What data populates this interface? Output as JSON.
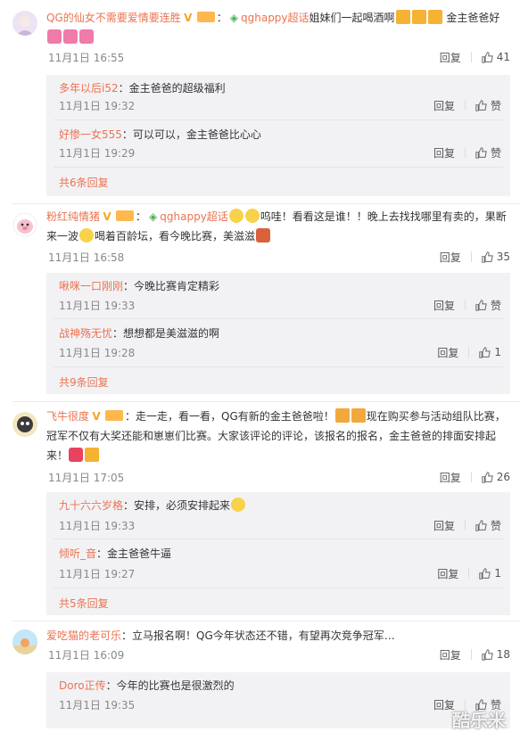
{
  "comments": [
    {
      "username": "QG的仙女不需要爱情要连胜",
      "topic": "qghappy超话",
      "text": "姐妹们一起喝酒啊",
      "text2": "金主爸爸好",
      "time": "11月1日 16:55",
      "reply_label": "回复",
      "likes": "41",
      "replies": [
        {
          "username": "多年以后i52",
          "text": "：金主爸爸的超级福利",
          "time": "11月1日 19:32",
          "reply_label": "回复",
          "likes": "赞"
        },
        {
          "username": "好惨一女555",
          "text": "：可以可以，金主爸爸比心心",
          "time": "11月1日 19:29",
          "reply_label": "回复",
          "likes": "赞"
        }
      ],
      "more": "共6条回复"
    },
    {
      "username": "粉红纯情猪",
      "topic": "qghappy超话",
      "text": "呜哇！看看这是谁！！晚上去找找哪里有卖的，果断",
      "text2": "来一波",
      "text3": "喝着百龄坛，看今晚比赛，美滋滋",
      "time": "11月1日 16:58",
      "reply_label": "回复",
      "likes": "35",
      "replies": [
        {
          "username": "啾咪一口刚刚",
          "text": "：今晚比赛肯定精彩",
          "time": "11月1日 19:33",
          "reply_label": "回复",
          "likes": "赞"
        },
        {
          "username": "战神殇无忧",
          "text": "：想想都是美滋滋的啊",
          "time": "11月1日 19:28",
          "reply_label": "回复",
          "likes": "1"
        }
      ],
      "more": "共9条回复"
    },
    {
      "username": "飞牛很度",
      "text": "：走一走，看一看，QG有新的金主爸爸啦！",
      "text_b": "现在购买参与活动组队比赛，",
      "text2": "冠军不仅有大奖还能和崽崽们比赛。大家该评论的评论，该报名的报名，金主爸爸的排面安排起",
      "text3": "来！",
      "time": "11月1日 17:05",
      "reply_label": "回复",
      "likes": "26",
      "replies": [
        {
          "username": "九十六六岁格",
          "text": "：安排，必须安排起来",
          "time": "11月1日 19:33",
          "reply_label": "回复",
          "likes": "赞"
        },
        {
          "username": "倾听_音",
          "text": "：金主爸爸牛逼",
          "time": "11月1日 19:27",
          "reply_label": "回复",
          "likes": "1"
        }
      ],
      "more": "共5条回复"
    },
    {
      "username": "爱吃猫的老可乐",
      "text": "：立马报名啊！QG今年状态还不错，有望再次竞争冠军…",
      "time": "11月1日 16:09",
      "reply_label": "回复",
      "likes": "18",
      "replies": [
        {
          "username": "Doro正传",
          "text": "：今年的比赛也是很激烈的",
          "time": "11月1日 19:35",
          "reply_label": "回复",
          "likes": "赞"
        }
      ]
    }
  ],
  "watermark": "酷乐米",
  "colors": {
    "accent": "#eb7350",
    "meta": "#888888",
    "subbox": "#f2f2f5"
  },
  "icons": [
    "thumb-up-icon",
    "vip-v-icon",
    "level-badge-icon",
    "super-topic-icon"
  ]
}
